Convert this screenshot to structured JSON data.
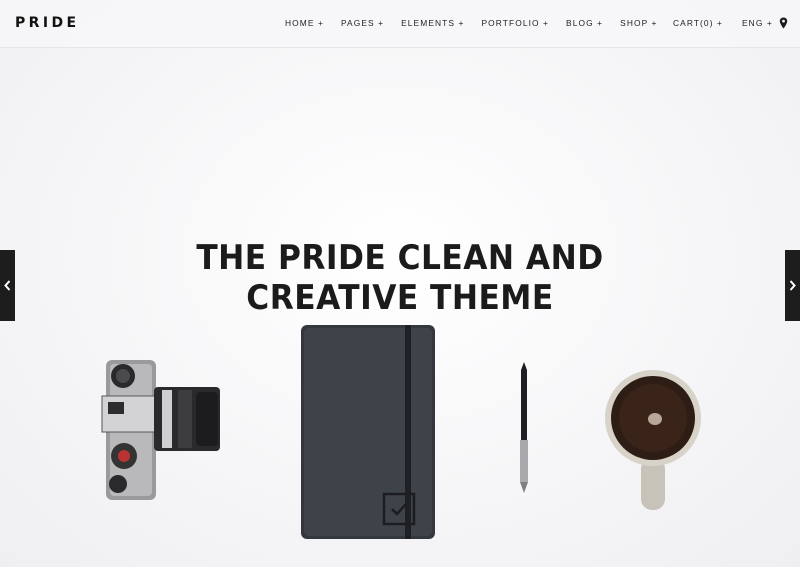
{
  "brand": {
    "logo_text": "PRIDE"
  },
  "nav": {
    "items": [
      {
        "label": "HOME +"
      },
      {
        "label": "PAGES +"
      },
      {
        "label": "ELEMENTS +"
      },
      {
        "label": "PORTFOLIO +"
      },
      {
        "label": "BLOG +"
      },
      {
        "label": "SHOP +"
      }
    ],
    "cart_label": "CART(0) +",
    "language_label": "ENG +",
    "location_icon": "map-pin-icon"
  },
  "hero": {
    "title_line1": "THE PRIDE CLEAN AND",
    "title_line2": "CREATIVE THEME",
    "prev_icon": "chevron-left-icon",
    "next_icon": "chevron-right-icon"
  },
  "colors": {
    "text": "#1b1b1b",
    "arrow_bg": "#1d1d1d",
    "background": "#f3f3f5"
  }
}
